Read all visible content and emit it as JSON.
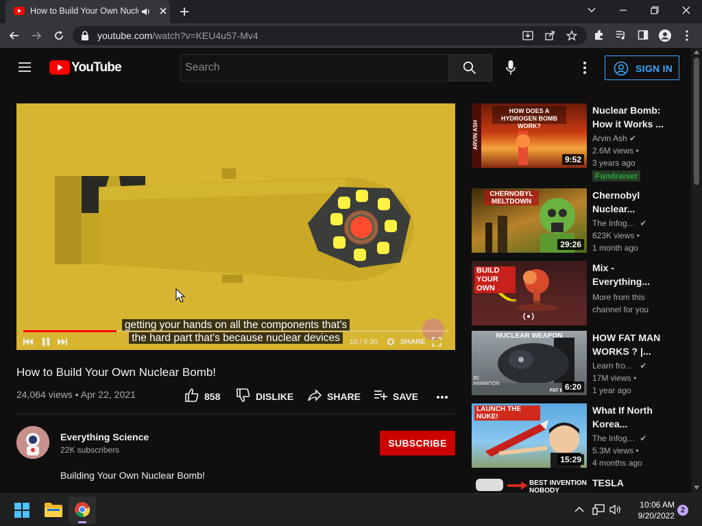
{
  "browser": {
    "tab_title": "How to Build Your Own Nuclear Bomb!",
    "url_host": "youtube.com",
    "url_path": "/watch?v=KEU4u57-Mv4"
  },
  "masthead": {
    "logo_text": "YouTube",
    "search_placeholder": "Search",
    "signin_label": "SIGN IN"
  },
  "player": {
    "caption_line1": "getting your hands on all the components that's",
    "caption_line2": "the hard part that's because nuclear devices",
    "time": "10 / 0:30",
    "share_label": "SHARE",
    "progress": 0.22
  },
  "video": {
    "title": "How to Build Your Own Nuclear Bomb!",
    "meta": "24,064 views • Apr 22, 2021",
    "like_count": "858",
    "dislike_label": "DISLIKE",
    "share_label": "SHARE",
    "save_label": "SAVE"
  },
  "channel": {
    "name": "Everything Science",
    "subs": "22K subscribers",
    "subscribe_label": "SUBSCRIBE",
    "description": "Building Your Own Nuclear Bomb!"
  },
  "related": [
    {
      "title": "Nuclear Bomb: How it Works ...",
      "channel": "Arvin Ash",
      "views": "2.6M views •",
      "age": "3 years ago",
      "duration": "9:52",
      "badge": "Fundraiser",
      "thumb_text": "HOW DOES A HYDROGEN BOMB WORK?",
      "thumb_side": "ARVIN ASH"
    },
    {
      "title": "Chernobyl Nuclear...",
      "channel": "The Infograp...",
      "views": "623K views •",
      "age": "1 month ago",
      "duration": "29:26",
      "thumb_text": "CHERNOBYL MELTDOWN"
    },
    {
      "title": "Mix - Everything...",
      "channel": "",
      "views": "More from this",
      "age": "channel for you",
      "duration": "",
      "thumb_text": "BUILD YOUR OWN"
    },
    {
      "title": "HOW FAT MAN WORKS ? |...",
      "channel": "Learn from t...",
      "views": "17M views •",
      "age": "1 year ago",
      "duration": "6:20",
      "thumb_text": "NUCLEAR WEAPON",
      "thumb_sub": "3D ANIMATION",
      "thumb_tag": "FAT M"
    },
    {
      "title": "What If North Korea...",
      "channel": "The Infograp...",
      "views": "5.3M views •",
      "age": "4 months ago",
      "duration": "15:29",
      "thumb_text": "LAUNCH THE NUKE!"
    },
    {
      "title": "TESLA",
      "thumb_text": "BEST INVENTION NOBODY"
    }
  ],
  "taskbar": {
    "time": "10:06 AM",
    "date": "9/20/2022",
    "notifications": "2"
  }
}
